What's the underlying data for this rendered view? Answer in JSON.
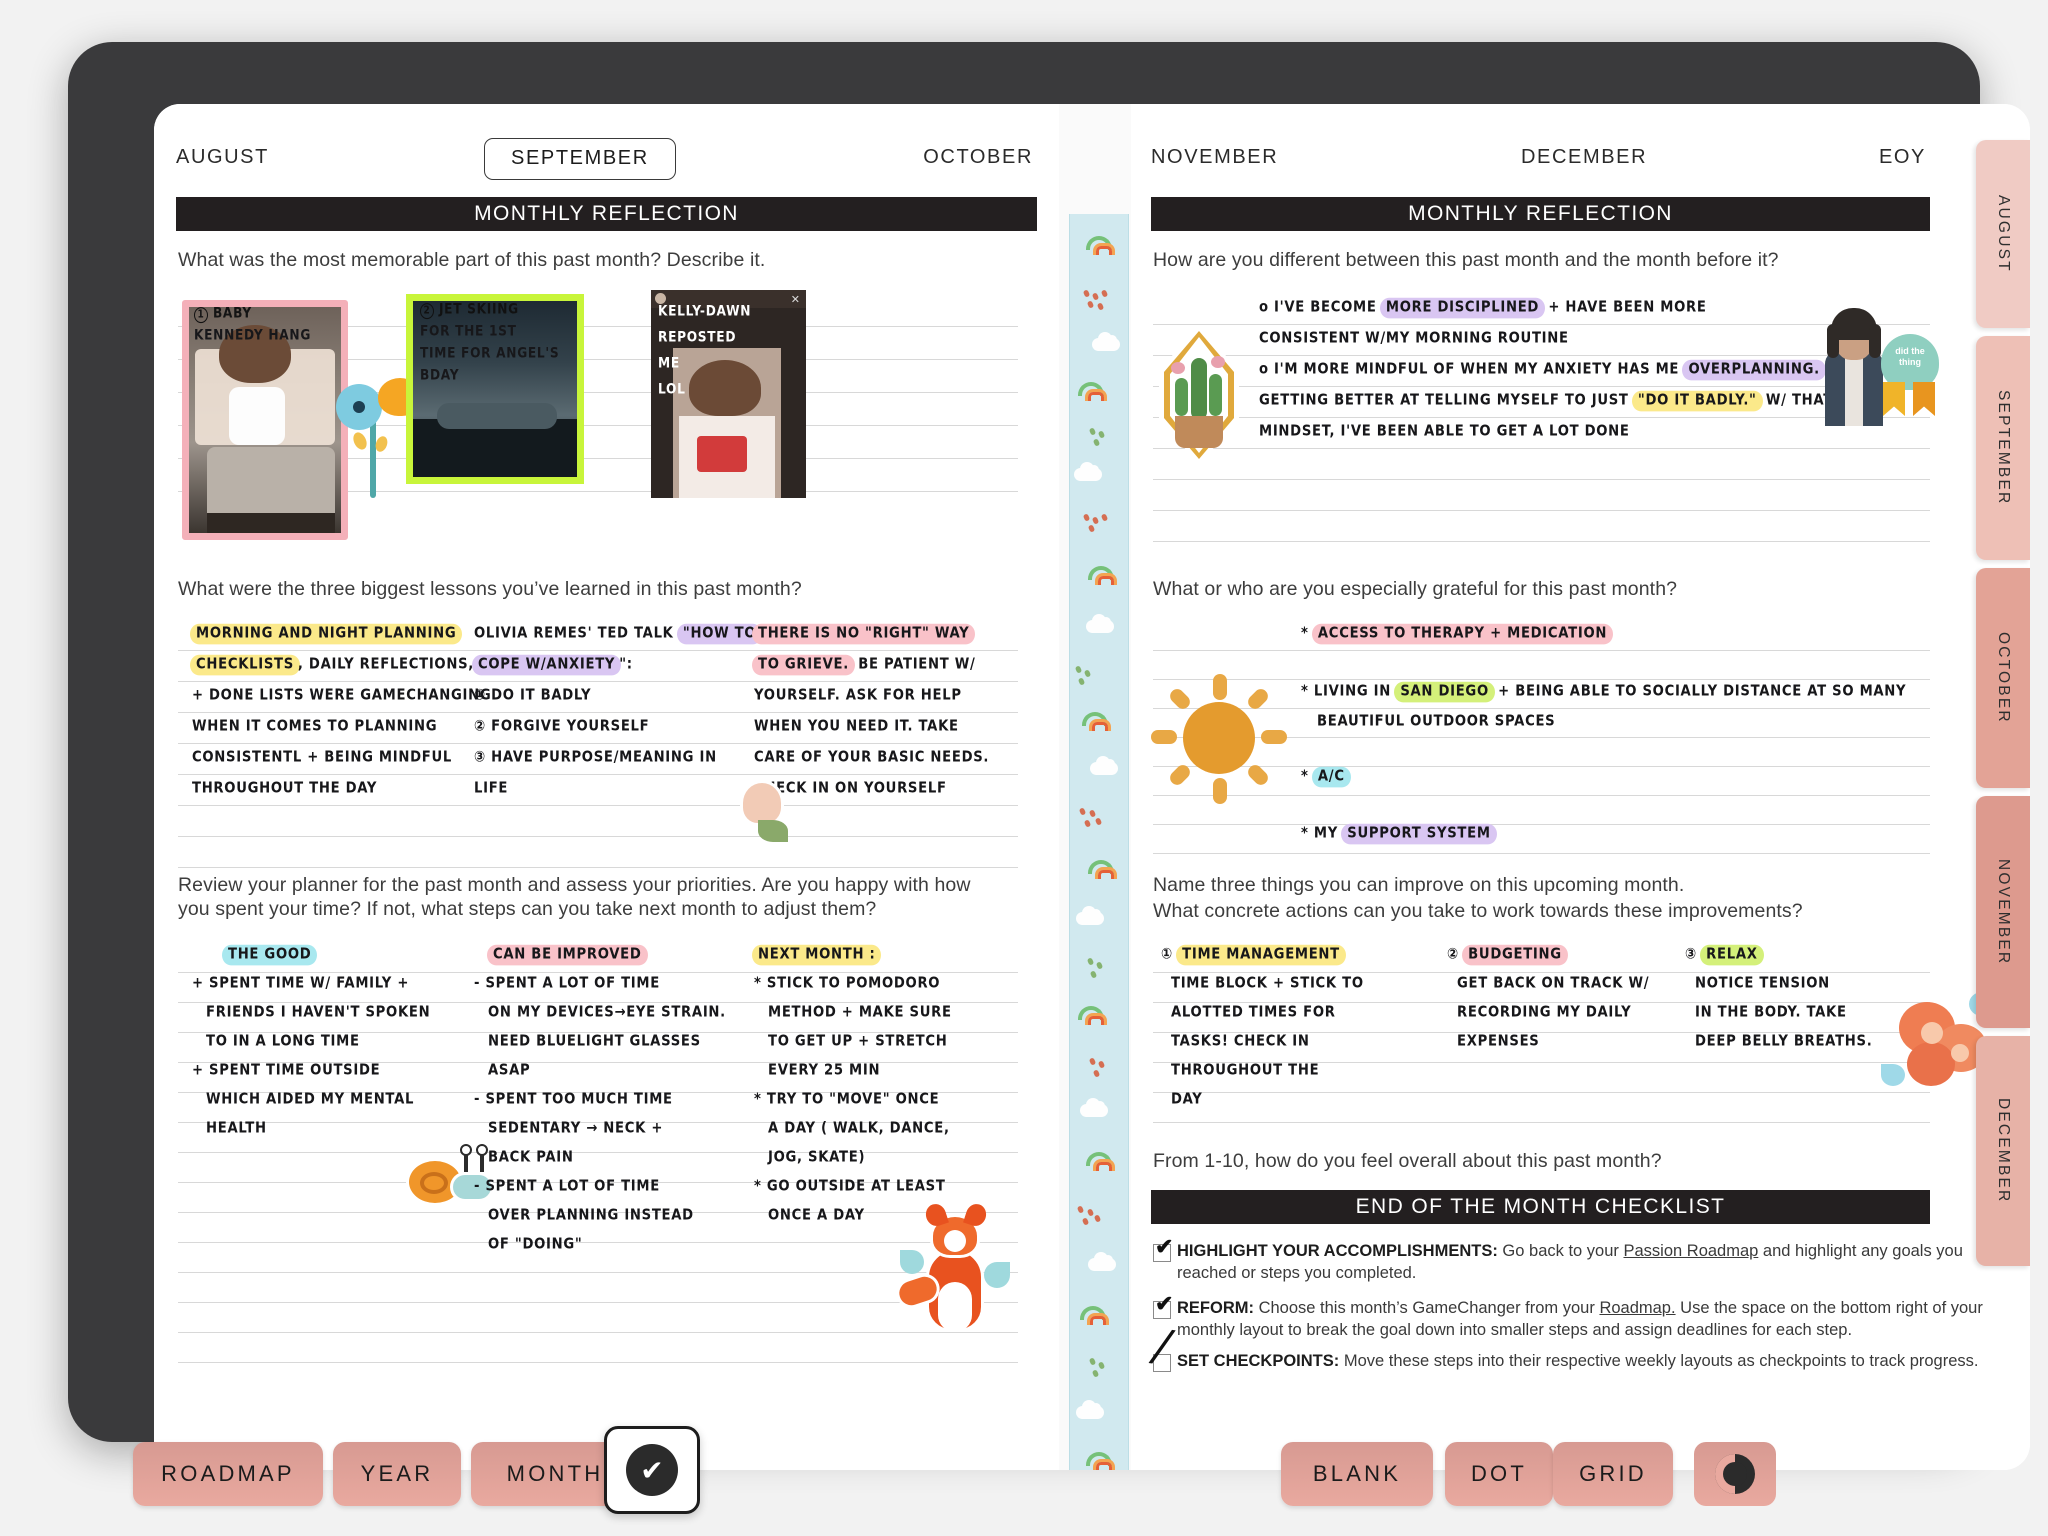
{
  "app": {
    "device": "tablet-planner"
  },
  "left_page": {
    "nav": {
      "prev": "AUGUST",
      "current": "SEPTEMBER",
      "next": "OCTOBER"
    },
    "banner": "MONTHLY REFLECTION",
    "prompt1": "What was the most memorable part of this past month? Describe it.",
    "photos": [
      {
        "caption": "BABY KENNEDY HANG",
        "frame_color": "#f4b0b9",
        "number": "1"
      },
      {
        "caption": "JET SKIING FOR THE 1ST TIME FOR ANGEL'S BDAY",
        "frame_color": "#c8f53a",
        "number": "2"
      },
      {
        "caption": "KELLY-DAWN REPOSTED ME LOL",
        "frame_color": "#2a2a2a",
        "number": ""
      }
    ],
    "prompt2": "What were the three biggest lessons you’ve learned in this past month?",
    "lessons": {
      "col1": [
        {
          "text": "MORNING AND NIGHT PLANNING",
          "hl": "y"
        },
        {
          "text": "CHECKLISTS",
          "hl": "y",
          "tail": ", DAILY  REFLECTIONS,"
        },
        {
          "text": "+  DONE  LISTS  WERE  GAMECHANGING"
        },
        {
          "text": "WHEN IT COMES  TO  PLANNING"
        },
        {
          "text": "CONSISTENTL + BEING MINDFUL"
        },
        {
          "text": "THROUGHOUT  THE  DAY"
        }
      ],
      "col2": [
        {
          "text": "OLIVIA REMES' TED TALK",
          "tail2": "\"HOW  TO",
          "hl2": "lav"
        },
        {
          "text": "COPE W/ANXIETY",
          "hl": "lav",
          "tail": "\":"
        },
        {
          "text": "① DO  IT BADLY"
        },
        {
          "text": "② FORGIVE YOURSELF"
        },
        {
          "text": "③ HAVE PURPOSE/MEANING IN"
        },
        {
          "text": "LIFE"
        }
      ],
      "col3": [
        {
          "text": "THERE  IS  NO \"RIGHT\" WAY",
          "hl": "pk"
        },
        {
          "text": "TO GRIEVE.",
          "hl": "pk",
          "tail": " BE PATIENT W/"
        },
        {
          "text": "YOURSELF. ASK FOR HELP"
        },
        {
          "text": "WHEN YOU NEED IT. TAKE"
        },
        {
          "text": "CARE OF YOUR  BASIC NEEDS."
        },
        {
          "text": "CHECK IN ON YOURSELF"
        }
      ]
    },
    "prompt3_line1": "Review your planner for the past month and assess your priorities. Are you happy with how",
    "prompt3_line2": "you spent your time? If not, what steps can you take next month to adjust them?",
    "review_table": {
      "headers": [
        {
          "text": "THE  GOOD",
          "hl": "b"
        },
        {
          "text": "CAN BE IMPROVED",
          "hl": "pk"
        },
        {
          "text": "NEXT MONTH :",
          "hl": "y"
        }
      ],
      "col1": [
        "+  SPENT TIME W/ FAMILY +",
        "FRIENDS I HAVEN'T  SPOKEN",
        "TO IN A LONG TIME",
        "+  SPENT TIME  OUTSIDE",
        "WHICH AIDED MY   MENTAL",
        "HEALTH"
      ],
      "col2": [
        "-  SPENT A LOT OF TIME",
        "ON MY  DEVICES→EYE  STRAIN.",
        "NEED BLUELIGHT GLASSES",
        "ASAP",
        "-  SPENT TOO MUCH TIME",
        "SEDENTARY → NECK +",
        "BACK PAIN",
        "-  SPENT A LOT OF  TIME",
        "OVER PLANNING  INSTEAD",
        "OF \"DOING\""
      ],
      "col3": [
        "*  STICK TO POMODORO",
        "METHOD + MAKE  SURE",
        "TO  GET UP + STRETCH",
        "EVERY 25 MIN",
        "*  TRY TO \"MOVE\" ONCE",
        "A DAY ( WALK, DANCE,",
        "JOG, SKATE)",
        "*  GO OUTSIDE AT  LEAST",
        "ONCE A          DAY"
      ]
    }
  },
  "right_page": {
    "nav": {
      "prev": "NOVEMBER",
      "current": "DECEMBER",
      "next": "EOY"
    },
    "banner": "MONTHLY REFLECTION",
    "prompt1": "How are you different between this past month and the month before it?",
    "reflection": [
      {
        "pre": "o  I'VE  BECOME  ",
        "hl": "MORE DISCIPLINED",
        "hlc": "lav",
        "post": " + HAVE BEEN  MORE"
      },
      {
        "pre": "CONSISTENT  W/MY   MORNING  ROUTINE"
      },
      {
        "pre": "o  I'M  MORE  MINDFUL  OF  WHEN  MY  ANXIETY  HAS  ME  ",
        "hl": "OVERPLANNING.",
        "hlc": "lav"
      },
      {
        "pre": "GETTING  BETTER  AT  TELLING MYSELF  TO   JUST  ",
        "hl": "\"DO IT BADLY.\"",
        "hlc": "y",
        "post": "  W/ THAT"
      },
      {
        "pre": "MINDSET, I'VE BEEN ABLE  TO  GET A LOT DONE"
      }
    ],
    "badge_sticker": "did the thing",
    "prompt2": "What or who are you especially grateful for this past month?",
    "gratitude": [
      {
        "star": "*",
        "pre": "",
        "hl": "ACCESS TO THERAPY + MEDICATION",
        "hlc": "pk",
        "post": ""
      },
      {
        "star": "*",
        "pre": "LIVING IN ",
        "hl": "SAN DIEGO",
        "hlc": "g",
        "post": " + BEING ABLE TO SOCIALLY  DISTANCE AT SO MANY"
      },
      {
        "star": "",
        "pre": "BEAUTIFUL OUTDOOR SPACES",
        "hl": "",
        "hlc": "",
        "post": ""
      },
      {
        "star": "*",
        "pre": "",
        "hl": "A/C",
        "hlc": "b",
        "post": ""
      },
      {
        "star": "*",
        "pre": "MY  ",
        "hl": "SUPPORT  SYSTEM",
        "hlc": "lav",
        "post": ""
      }
    ],
    "prompt3_line1": "Name three things you can improve on this upcoming month.",
    "prompt3_line2": "What concrete actions can you take to work towards these improvements?",
    "improve_table": {
      "headers": [
        {
          "num": "①",
          "text": "TIME MANAGEMENT",
          "hl": "y"
        },
        {
          "num": "②",
          "text": "BUDGETING",
          "hl": "pk"
        },
        {
          "num": "③",
          "text": "RELAX",
          "hl": "g"
        }
      ],
      "col1": [
        "TIME BLOCK + STICK TO",
        "ALOTTED TIMES FOR",
        "TASKS! CHECK IN",
        "THROUGHOUT THE",
        "DAY"
      ],
      "col2": [
        "GET  BACK ON TRACK W/",
        "RECORDING MY DAILY",
        "EXPENSES"
      ],
      "col3": [
        "NOTICE TENSION",
        "IN THE BODY. TAKE",
        "DEEP BELLY BREATHS."
      ]
    },
    "prompt4": "From 1-10, how do you feel overall about this past month?",
    "checklist_banner": "END OF THE MONTH CHECKLIST",
    "checklist": [
      {
        "checked": true,
        "title": "HIGHLIGHT YOUR ACCOMPLISHMENTS:",
        "body": " Go back to your ",
        "link": "Passion Roadmap",
        "body2": " and highlight any goals you",
        "body3": "reached or steps you completed."
      },
      {
        "checked": true,
        "title": "REFORM:",
        "body": " Choose this month’s GameChanger from your ",
        "link": "Roadmap.",
        "body2": " Use the space on the bottom right of your",
        "body3": "monthly layout to break the goal down into smaller steps and assign deadlines for each step."
      },
      {
        "checked": true,
        "title": "SET CHECKPOINTS:",
        "body": " Move these steps into their respective weekly layouts as checkpoints to track progress.",
        "link": "",
        "body2": "",
        "body3": ""
      }
    ]
  },
  "index_tabs": [
    {
      "label": "AUGUST",
      "color": "#f0cbc4"
    },
    {
      "label": "SEPTEMBER",
      "color": "#eec0b6"
    },
    {
      "label": "OCTOBER",
      "color": "#e3a396"
    },
    {
      "label": "NOVEMBER",
      "color": "#dd9a8e"
    },
    {
      "label": "DECEMBER",
      "color": "#e7b2a7"
    }
  ],
  "toolbar": {
    "left": [
      "ROADMAP",
      "YEAR",
      "MONTH"
    ],
    "check_icon": "check-icon",
    "right": [
      "BLANK",
      "DOT",
      "GRID"
    ],
    "pen_icon": "pen-nib-icon"
  },
  "colors": {
    "banner_bg": "#231f20",
    "tab_accent": "#e3a396",
    "washi": "#cfe9ef"
  }
}
